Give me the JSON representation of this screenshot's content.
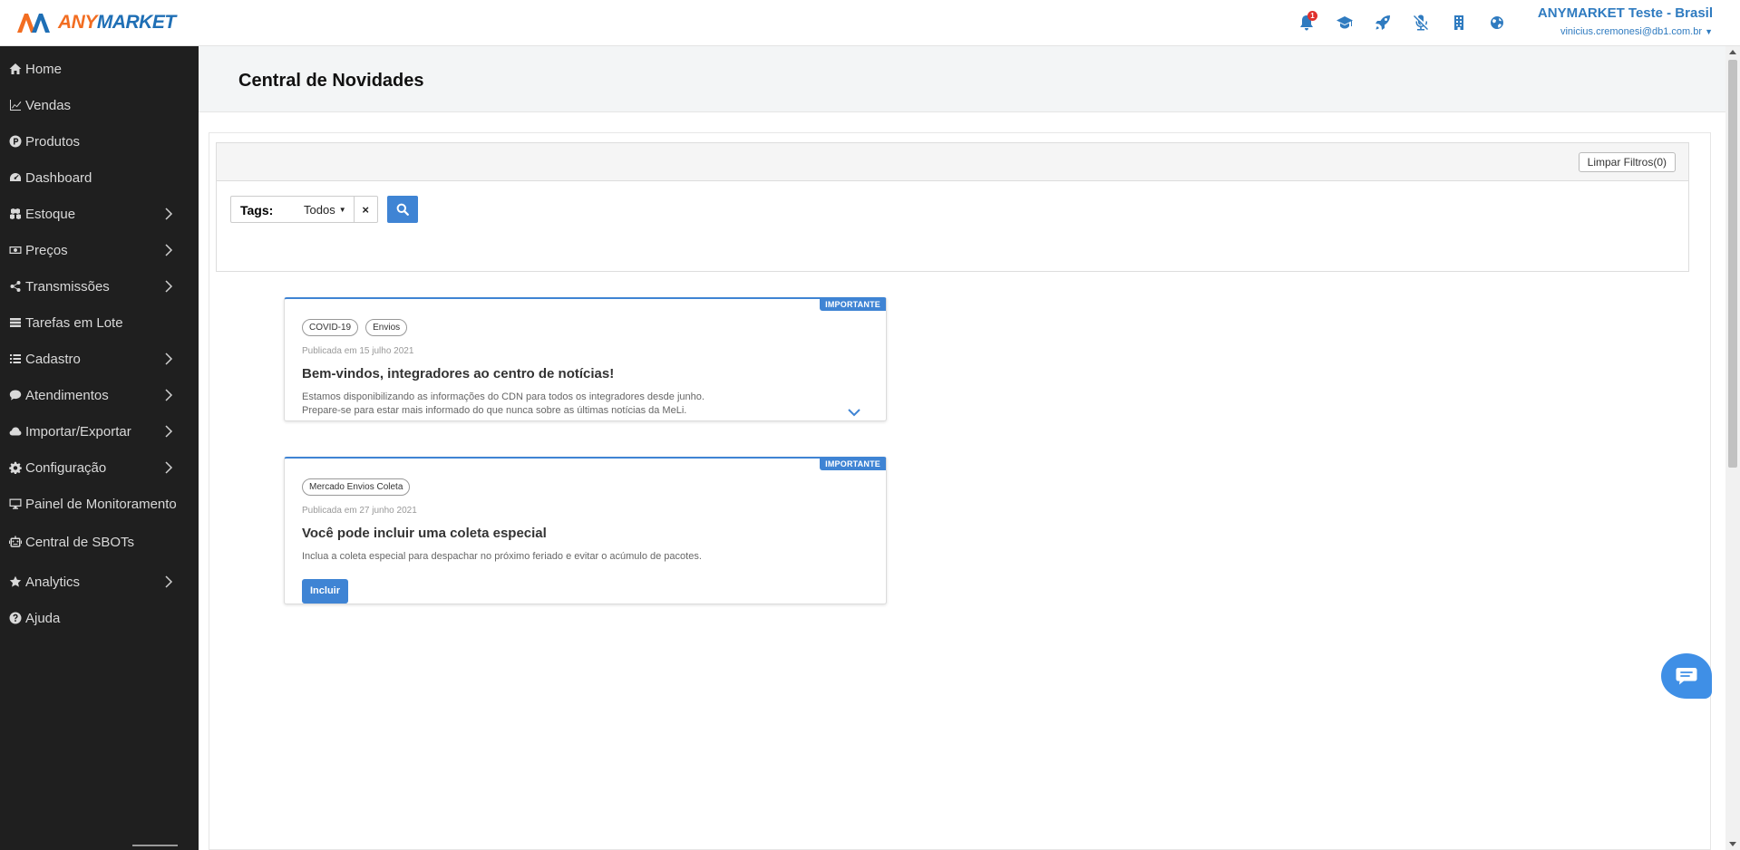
{
  "brand": {
    "name_part1": "ANY",
    "name_part2": "MARKET",
    "orange": "#f26d21",
    "blue": "#1f6fb5"
  },
  "header": {
    "icons": [
      "bell-icon",
      "graduation-cap-icon",
      "rocket-icon",
      "microphone-slash-icon",
      "building-icon",
      "globe-icon"
    ],
    "notification_count": "1",
    "account_name": "ANYMARKET Teste - Brasil",
    "account_email": "vinicius.cremonesi@db1.com.br"
  },
  "sidebar": {
    "items": [
      {
        "label": "Home",
        "icon": "home-icon",
        "submenu": false
      },
      {
        "label": "Vendas",
        "icon": "line-chart-icon",
        "submenu": false
      },
      {
        "label": "Produtos",
        "icon": "product-hunt-icon",
        "submenu": false
      },
      {
        "label": "Dashboard",
        "icon": "dashboard-icon",
        "submenu": false
      },
      {
        "label": "Estoque",
        "icon": "cubes-icon",
        "submenu": true
      },
      {
        "label": "Preços",
        "icon": "money-icon",
        "submenu": true
      },
      {
        "label": "Transmissões",
        "icon": "share-icon",
        "submenu": true
      },
      {
        "label": "Tarefas em Lote",
        "icon": "tasks-icon",
        "submenu": false
      },
      {
        "label": "Cadastro",
        "icon": "list-icon",
        "submenu": true
      },
      {
        "label": "Atendimentos",
        "icon": "comments-icon",
        "submenu": true
      },
      {
        "label": "Importar/Exportar",
        "icon": "cloud-icon",
        "submenu": true
      },
      {
        "label": "Configuração",
        "icon": "cog-icon",
        "submenu": true
      },
      {
        "label": "Painel de Monitoramento",
        "icon": "desktop-icon",
        "submenu": false
      },
      {
        "label": "Central de SBOTs",
        "icon": "robot-icon",
        "submenu": false
      },
      {
        "label": "Analytics",
        "icon": "star-icon",
        "submenu": true
      },
      {
        "label": "Ajuda",
        "icon": "question-circle-icon",
        "submenu": false
      }
    ]
  },
  "page": {
    "title": "Central de Novidades"
  },
  "filters": {
    "clear_label": "Limpar Filtros(0)",
    "tags_label": "Tags:",
    "tags_value": "Todos",
    "clear_tag": "×"
  },
  "news": [
    {
      "badge": "IMPORTANTE",
      "tags": [
        "COVID-19",
        "Envios"
      ],
      "published": "Publicada em 15 julho 2021",
      "title": "Bem-vindos, integradores ao centro de notícias!",
      "text_line1": "Estamos disponibilizando as informações do CDN para todos os integradores desde junho.",
      "text_line2": "Prepare-se para estar mais informado do que nunca sobre as últimas notícias da MeLi."
    },
    {
      "badge": "IMPORTANTE",
      "tags": [
        "Mercado Envios Coleta"
      ],
      "published": "Publicada em 27 junho 2021",
      "title": "Você pode incluir uma coleta especial",
      "text_line1": "Inclua a coleta especial para despachar no próximo feriado e evitar o acúmulo de pacotes.",
      "button": "Incluir"
    }
  ],
  "colors": {
    "accent": "#3f84d4",
    "sidebar_bg": "#1f1f1f",
    "header_blue": "#2f7bc0",
    "notif_red": "#e0312d"
  }
}
